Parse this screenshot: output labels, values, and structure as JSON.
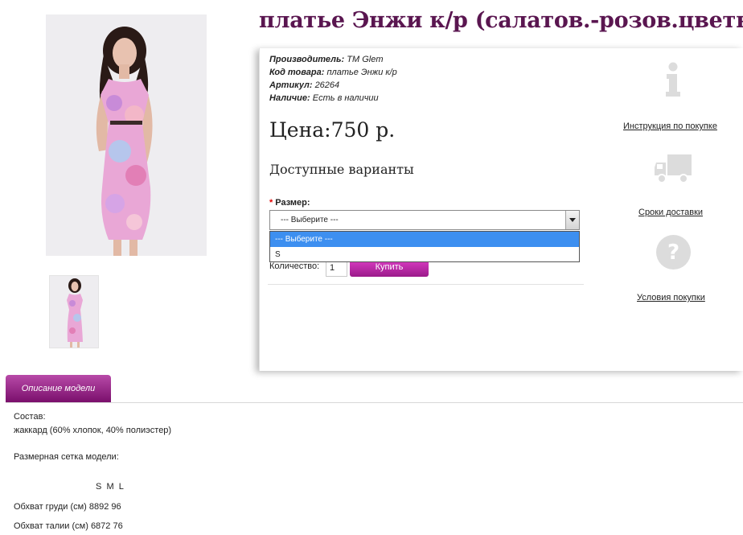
{
  "product": {
    "title": "платье Энжи к/р (салатов.-розов.цветы)",
    "meta": [
      {
        "label": "Производитель:",
        "value": "TM Glem"
      },
      {
        "label": "Код товара:",
        "value": "платье Энжи к/р"
      },
      {
        "label": "Артикул:",
        "value": "26264"
      },
      {
        "label": "Наличие:",
        "value": "Есть в наличии"
      }
    ],
    "price": "Цена:750 р.",
    "variants_heading": "Доступные варианты"
  },
  "options": {
    "size_required_mark": "*",
    "size_label": "Размер:",
    "size_selected": "--- Выберите ---",
    "size_options": [
      "--- Выберите ---",
      "S"
    ]
  },
  "purchase": {
    "qty_label": "Количество:",
    "qty_value": "1",
    "buy_label": "Купить"
  },
  "side_links": {
    "instruction": {
      "label": "Инструкция по покупке",
      "icon": "info-icon"
    },
    "delivery": {
      "label": "Сроки доставки",
      "icon": "truck-icon"
    },
    "terms": {
      "label": "Условия покупки",
      "icon": "question-icon"
    }
  },
  "tabs": [
    {
      "label": "Описание модели",
      "active": true
    }
  ],
  "description": {
    "composition_label": "Состав:",
    "composition_value": "жаккард (60% хлопок, 40% полиэстер)",
    "size_chart_label": "Размерная сетка модели:",
    "size_header": "S  M  L",
    "rows": [
      {
        "label": "Обхват груди (см)",
        "values": "8892 96"
      },
      {
        "label": "Обхват талии (см)",
        "values": "6872 76"
      }
    ]
  },
  "colors": {
    "title": "#5a1650",
    "accent": "#9a1a8a",
    "dropdown_highlight": "#3d8ff0"
  }
}
